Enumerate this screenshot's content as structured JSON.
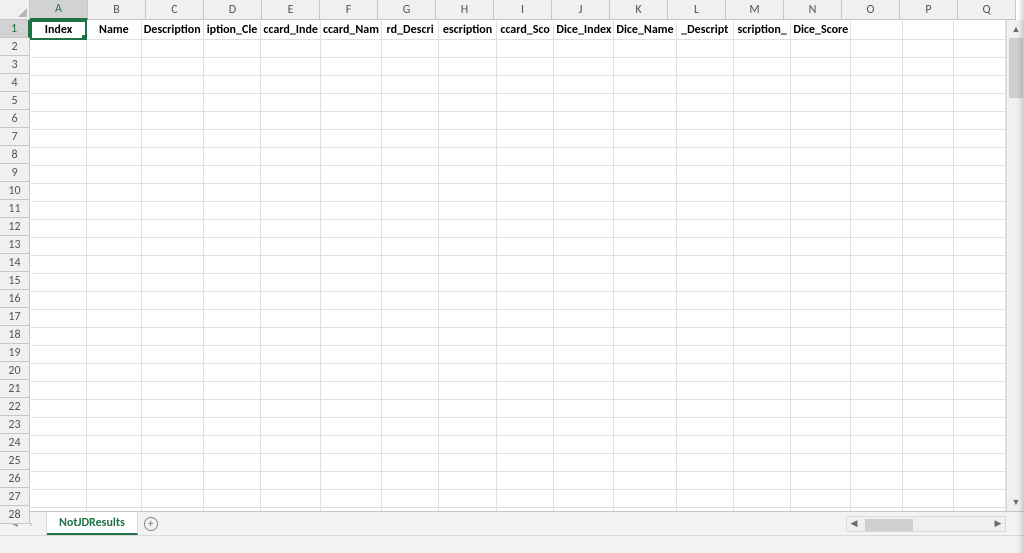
{
  "columns": [
    "A",
    "B",
    "C",
    "D",
    "E",
    "F",
    "G",
    "H",
    "I",
    "J",
    "K",
    "L",
    "M",
    "N",
    "O",
    "P",
    "Q"
  ],
  "selectedColumn": "A",
  "selectedRow": 1,
  "rowsVisible": 28,
  "headerRow": {
    "A": "Index",
    "B": "Name",
    "C": "Description",
    "D": "iption_Cle",
    "E": "ccard_Inde",
    "F": "ccard_Nam",
    "G": "rd_Descri",
    "H": "escription",
    "I": "ccard_Sco",
    "J": "Dice_Index",
    "K": "Dice_Name",
    "L": "_Descript",
    "M": "scription_",
    "N": "Dice_Score",
    "O": "",
    "P": "",
    "Q": ""
  },
  "tabs": {
    "active": "NotJDResults"
  },
  "icons": {
    "navFirst": "◄",
    "navPrev": "‹",
    "navNext": "›",
    "plus": "+",
    "arrowLeft": "◀",
    "arrowRight": "▶",
    "arrowUp": "▲",
    "arrowDown": "▼"
  }
}
